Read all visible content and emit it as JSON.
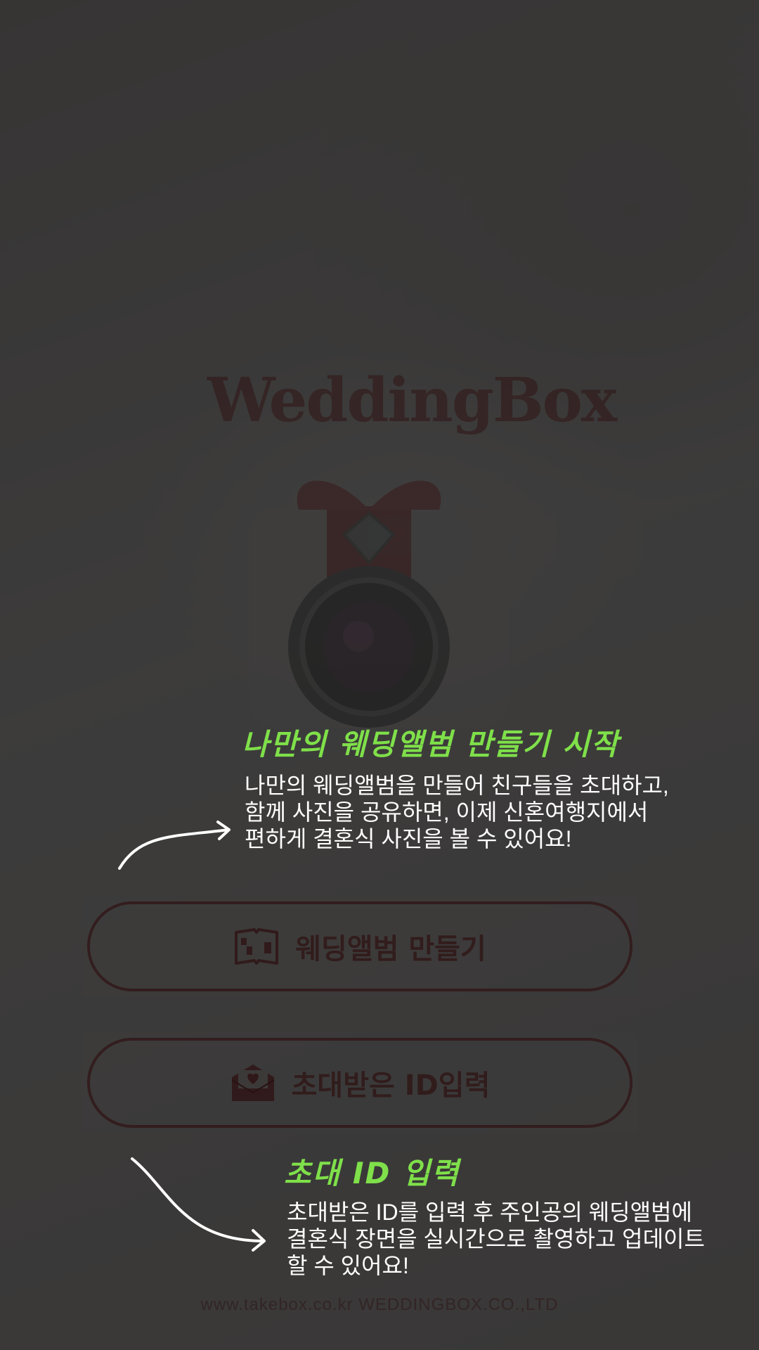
{
  "app": {
    "logo_text": "WeddingBox"
  },
  "guide_create": {
    "title": "나만의 웨딩앨범 만들기 시작",
    "lines": [
      "나만의 웨딩앨범을 만들어 친구들을 초대하고,",
      "함께 사진을 공유하면, 이제 신혼여행지에서",
      "편하게 결혼식 사진을 볼 수 있어요!"
    ]
  },
  "buttons": {
    "create_album": "웨딩앨범 만들기",
    "enter_invite_id": "초대받은 ID입력"
  },
  "guide_invite": {
    "title": "초대 ID 입력",
    "lines": [
      "초대받은 ID를 입력 후 주인공의 웨딩앨범에",
      "결혼식 장면을 실시간으로 촬영하고 업데이트",
      "할 수 있어요!"
    ]
  },
  "footer": {
    "text": "www.takebox.co.kr   WEDDINGBOX.CO.,LTD"
  },
  "colors": {
    "brand": "#a91e22",
    "guide_title": "#7fe04a",
    "overlay": "#121212"
  }
}
